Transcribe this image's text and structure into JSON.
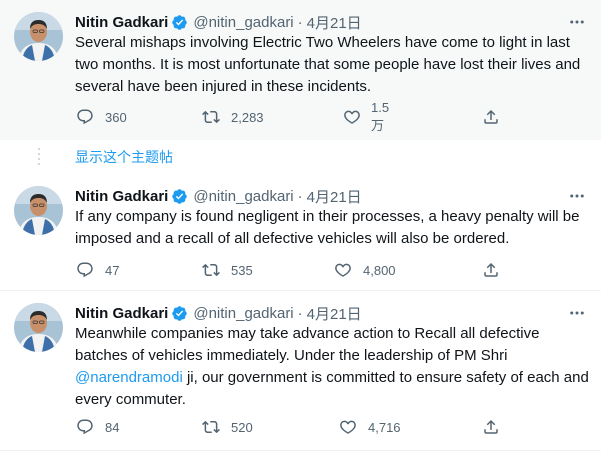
{
  "tweets": [
    {
      "name": "Nitin Gadkari",
      "handle": "@nitin_gadkari",
      "separator": "·",
      "date": "4月21日",
      "text": "Several mishaps involving Electric Two Wheelers have come to light in last two months. It is most unfortunate that some people have lost their lives and several have been injured in these incidents.",
      "replies": "360",
      "retweets": "2,283",
      "likes": "1.5万"
    },
    {
      "name": "Nitin Gadkari",
      "handle": "@nitin_gadkari",
      "separator": "·",
      "date": "4月21日",
      "text": "If any company is found negligent in their processes, a heavy penalty will be imposed and a recall of all defective vehicles will also be ordered.",
      "replies": "47",
      "retweets": "535",
      "likes": "4,800"
    },
    {
      "name": "Nitin Gadkari",
      "handle": "@nitin_gadkari",
      "separator": "·",
      "date": "4月21日",
      "text_before": "Meanwhile companies may take advance action to Recall all defective batches of vehicles immediately. Under the leadership of PM Shri ",
      "mention": "@narendramodi",
      "text_after": " ji, our government is committed to ensure safety of each and every commuter.",
      "replies": "84",
      "retweets": "520",
      "likes": "4,716"
    }
  ],
  "show_thread_label": "显示这个主题帖",
  "colors": {
    "accent": "#1d9bf0",
    "secondary_text": "#536471",
    "primary_text": "#0f1419",
    "highlight_bg": "#f7f9f9"
  },
  "icons": {
    "reply": "reply-icon",
    "retweet": "retweet-icon",
    "like": "like-icon",
    "share": "share-icon",
    "more": "more-icon",
    "verified": "verified-badge-icon"
  }
}
